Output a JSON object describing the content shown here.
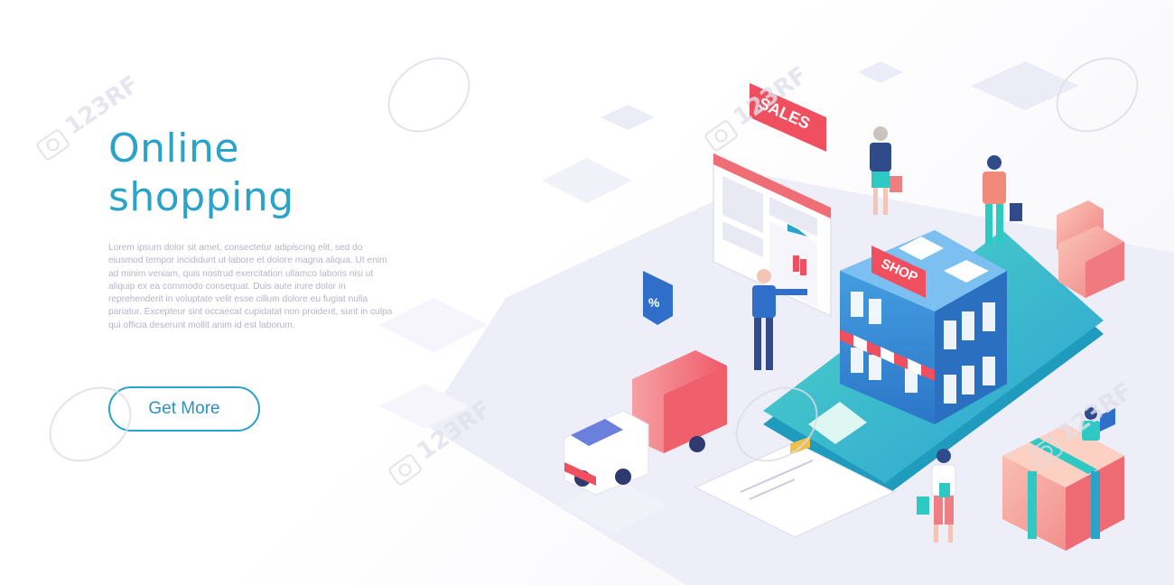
{
  "hero": {
    "title_line1": "Online",
    "title_line2": "shopping",
    "body": "Lorem ipsum dolor sit amet, consectetur adipiscing elit, sed do eiusmod tempor incididunt ut labore et dolore magna aliqua. Ut enim ad minim veniam, quis nostrud exercitation ullamco laboris nisi ut aliquip ex ea commodo consequat. Duis aute irure dolor in reprehenderit in voluptate velit esse cillum dolore eu fugiat nulla pariatur. Excepteur sint occaecat cupidatat non proident, sunt in culpa qui officia deserunt mollit anim id est laborum.",
    "cta_label": "Get More"
  },
  "illustration": {
    "sales_sign": "SALES",
    "shop_sign": "SHOP",
    "percent_label": "%"
  },
  "watermark": {
    "text": "123RF"
  },
  "colors": {
    "accent": "#2aa3c9",
    "body_text": "#b5b5c6",
    "phone": "#2fc9c4",
    "building": "#3a92d8",
    "sign_red": "#ef4f5f"
  },
  "icons": [
    "percent-tag-icon",
    "shopping-bag-icon",
    "truck-icon",
    "gift-box-icon",
    "shoe-icon",
    "boot-icon",
    "watermark-camera-icon"
  ]
}
